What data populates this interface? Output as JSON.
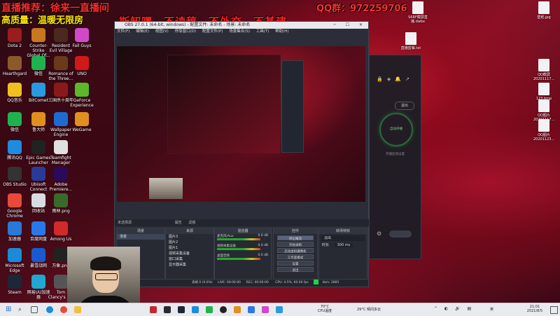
{
  "overlay": {
    "title_left": "直播推荐：徐来一直播间",
    "sub_left": "高质量：温暖无限房",
    "center_banner": "斯卸嘿，不读稿，不外交，不基建",
    "qq_group": "QQ群：972259706"
  },
  "desktop_icons": [
    {
      "label": "Dota 2",
      "color": "#9a1c1c"
    },
    {
      "label": "Hearthgard",
      "color": "#8a5a2a"
    },
    {
      "label": "QQ音乐",
      "color": "#f0c020"
    },
    {
      "label": "微信",
      "color": "#1fb34f"
    },
    {
      "label": "腾讯QQ",
      "color": "#1e8be0"
    },
    {
      "label": "OBS Studio",
      "color": "#333"
    },
    {
      "label": "Google Chrome",
      "color": "#e84a3a"
    },
    {
      "label": "加速器",
      "color": "#2a78d8"
    },
    {
      "label": "Microsoft Edge",
      "color": "#1b8ad8"
    },
    {
      "label": "Steam",
      "color": "#1b2838"
    },
    {
      "label": "Counter-Strike Global Of...",
      "color": "#c8781e"
    },
    {
      "label": "微信",
      "color": "#1fb34f"
    },
    {
      "label": "BitComet",
      "color": "#2a9ae0"
    },
    {
      "label": "鲁大师",
      "color": "#e0901e"
    },
    {
      "label": "Epic Games Launcher",
      "color": "#222"
    },
    {
      "label": "Ubisoft Connect",
      "color": "#2a3a9a"
    },
    {
      "label": "回收站",
      "color": "#d8dce0"
    },
    {
      "label": "百度网盘",
      "color": "#2a78e8"
    },
    {
      "label": "暴雪战网",
      "color": "#1a5ad0"
    },
    {
      "label": "网易UU加速器",
      "color": "#20a8d0"
    },
    {
      "label": "Resident Evil Village",
      "color": "#4a2a20"
    },
    {
      "label": "Romance of the Three...",
      "color": "#6a3a1a"
    },
    {
      "label": "三国杀十周年",
      "color": "#8a1a1a"
    },
    {
      "label": "Wallpaper Engine",
      "color": "#1e6ad0"
    },
    {
      "label": "Teamfight Manager",
      "color": "#e0e0e0"
    },
    {
      "label": "Adobe Premiere...",
      "color": "#2a0a5a"
    },
    {
      "label": "雨林.png",
      "color": "#3a6a2a"
    },
    {
      "label": "Among Us",
      "color": "#d02a2a"
    },
    {
      "label": "万象.png",
      "color": "#222"
    },
    {
      "label": "Tom Clancy's R...",
      "color": "#555"
    },
    {
      "label": "Fall Guys",
      "color": "#d04ac8"
    },
    {
      "label": "UNO",
      "color": "#d01a1a"
    },
    {
      "label": "GeForce Experience",
      "color": "#5ab82a"
    },
    {
      "label": "WeGame",
      "color": "#e0901e"
    }
  ],
  "right_desktop_icons": [
    {
      "label": "S6RF截屏直播.dwbx"
    },
    {
      "label": "直播剪辑.txt"
    },
    {
      "label": "QQ截屏20201117..."
    },
    {
      "label": "123.bmp"
    },
    {
      "label": "QQ图片20201117..."
    },
    {
      "label": "QQ图片20201123..."
    },
    {
      "label": "壁纸.jpg"
    }
  ],
  "obs": {
    "window_title": "OBS 27.0.1 (64-bit, windows) - 配置文件: 未命名 - 场景: 未命名",
    "menu": [
      "文件(F)",
      "编辑(E)",
      "视图(V)",
      "停靠窗口(D)",
      "配置文件(P)",
      "场景集合(S)",
      "工具(T)",
      "帮助(H)"
    ],
    "scene_bar_label": "未选择源",
    "scene_bar_props": "属性",
    "scene_bar_filters": "滤镜",
    "docks": {
      "scenes_title": "场景",
      "scenes": [
        "场景"
      ],
      "sources_title": "来源",
      "sources": [
        "图片3",
        "图片2",
        "图片1",
        "视频采集设备",
        "窗口采集",
        "显示器采集"
      ],
      "mixer_title": "混音器",
      "mixer": [
        {
          "name": "麦克风/Aux",
          "db": "0.0 dB"
        },
        {
          "name": "视频采集设备",
          "db": "0.0 dB"
        },
        {
          "name": "桌面音频",
          "db": "0.0 dB"
        }
      ],
      "transitions_title": "转场特效",
      "transition_type": "淡出",
      "duration_label": "时长",
      "duration_value": "300 ms",
      "controls_title": "控件",
      "controls": [
        "停止推流",
        "开始录制",
        "启动虚拟摄像机",
        "工作室模式",
        "设置",
        "退出"
      ]
    },
    "status": {
      "dropped": "丢帧 0 (0.0%)",
      "live_label": "LIVE:",
      "live_time": "00:00:00",
      "rec_label": "REC:",
      "rec_time": "00:00:00",
      "cpu": "CPU: 4.5%, 60.00 fps",
      "kbps": "kb/s: 2885"
    }
  },
  "rpanel": {
    "button_label": "退出",
    "ring_label": "自动开播",
    "hint": "开播后请设置"
  },
  "taskbar": {
    "weather_temp": "70°C",
    "weather_label": "CPU温度",
    "weather2": "29°C 晴间多云",
    "time": "21:01",
    "date": "2021/8/5",
    "lang": "英"
  }
}
